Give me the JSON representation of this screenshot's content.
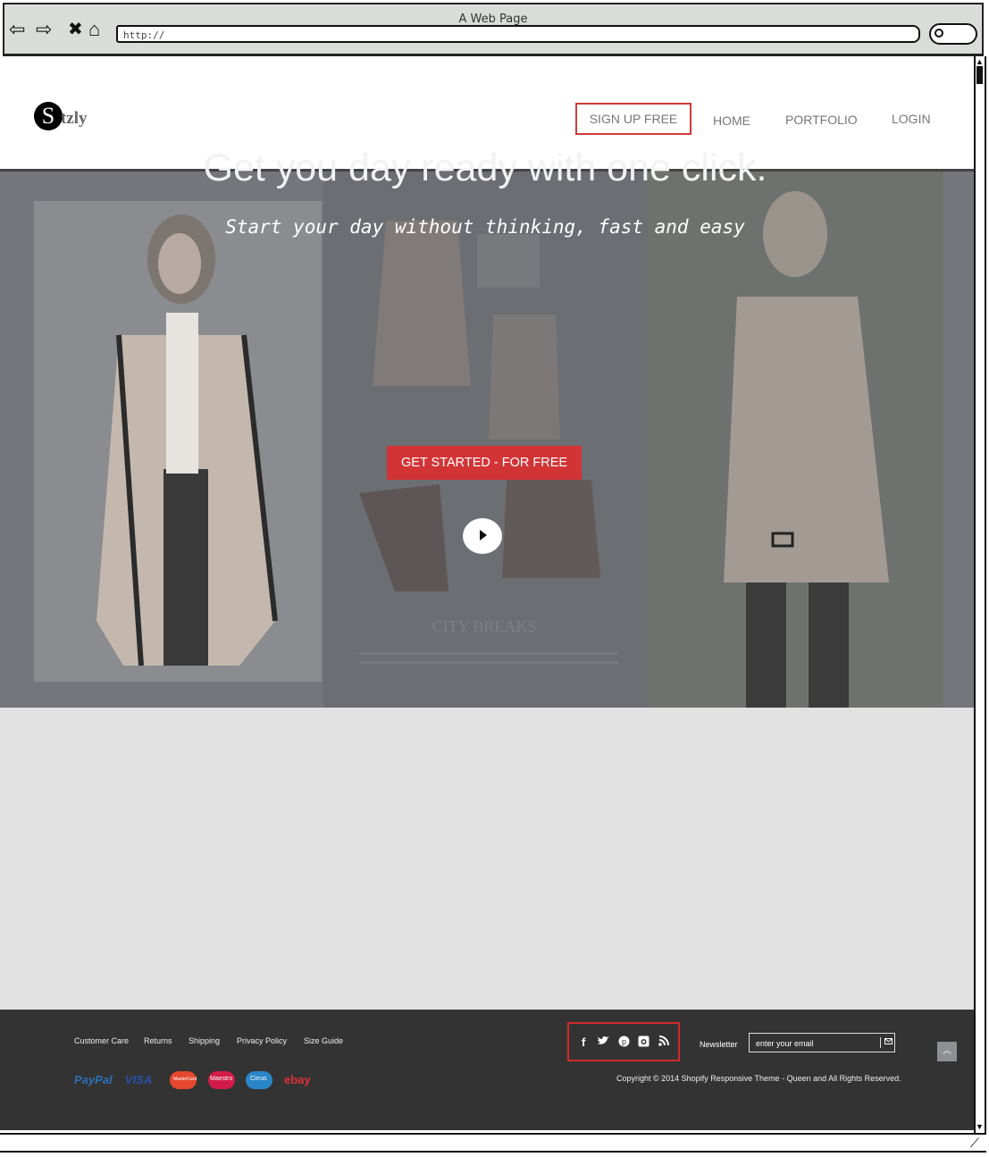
{
  "browser": {
    "title": "A Web Page",
    "url": "http://",
    "back_icon": "back-arrow-icon",
    "forward_icon": "forward-arrow-icon",
    "stop_icon": "close-icon",
    "home_icon": "home-icon",
    "search_icon": "search-icon"
  },
  "header": {
    "logo_initial": "S",
    "logo_rest": "tzly",
    "nav": {
      "signup": "SIGN UP FREE",
      "home": "HOME",
      "portfolio": "PORTFOLIO",
      "login": "LOGIN"
    }
  },
  "hero": {
    "title": "Get you day ready with one click.",
    "subtitle": "Start your day without thinking, fast and easy",
    "cta": "GET STARTED - FOR FREE",
    "play_icon": "play-icon",
    "background_caption": "CITY BREAKS"
  },
  "footer": {
    "links": [
      "Customer Care",
      "Returns",
      "Shipping",
      "Privacy Policy",
      "Size Guide"
    ],
    "payments": [
      "PayPal",
      "VISA",
      "MasterCard",
      "Maestro",
      "Cirrus",
      "ebay"
    ],
    "social_icons": [
      "facebook-icon",
      "twitter-icon",
      "pinterest-icon",
      "instagram-icon",
      "rss-icon"
    ],
    "newsletter_label": "Newsletter",
    "newsletter_placeholder": "enter your email",
    "copyright": "Copyright © 2014 Shopify Responsive Theme - Queen and All Rights Reserved.",
    "back_to_top_icon": "chevron-up-icon"
  },
  "colors": {
    "accent_red": "#d23436",
    "footer_bg": "#333333",
    "content_bg": "#e1e2e1"
  }
}
